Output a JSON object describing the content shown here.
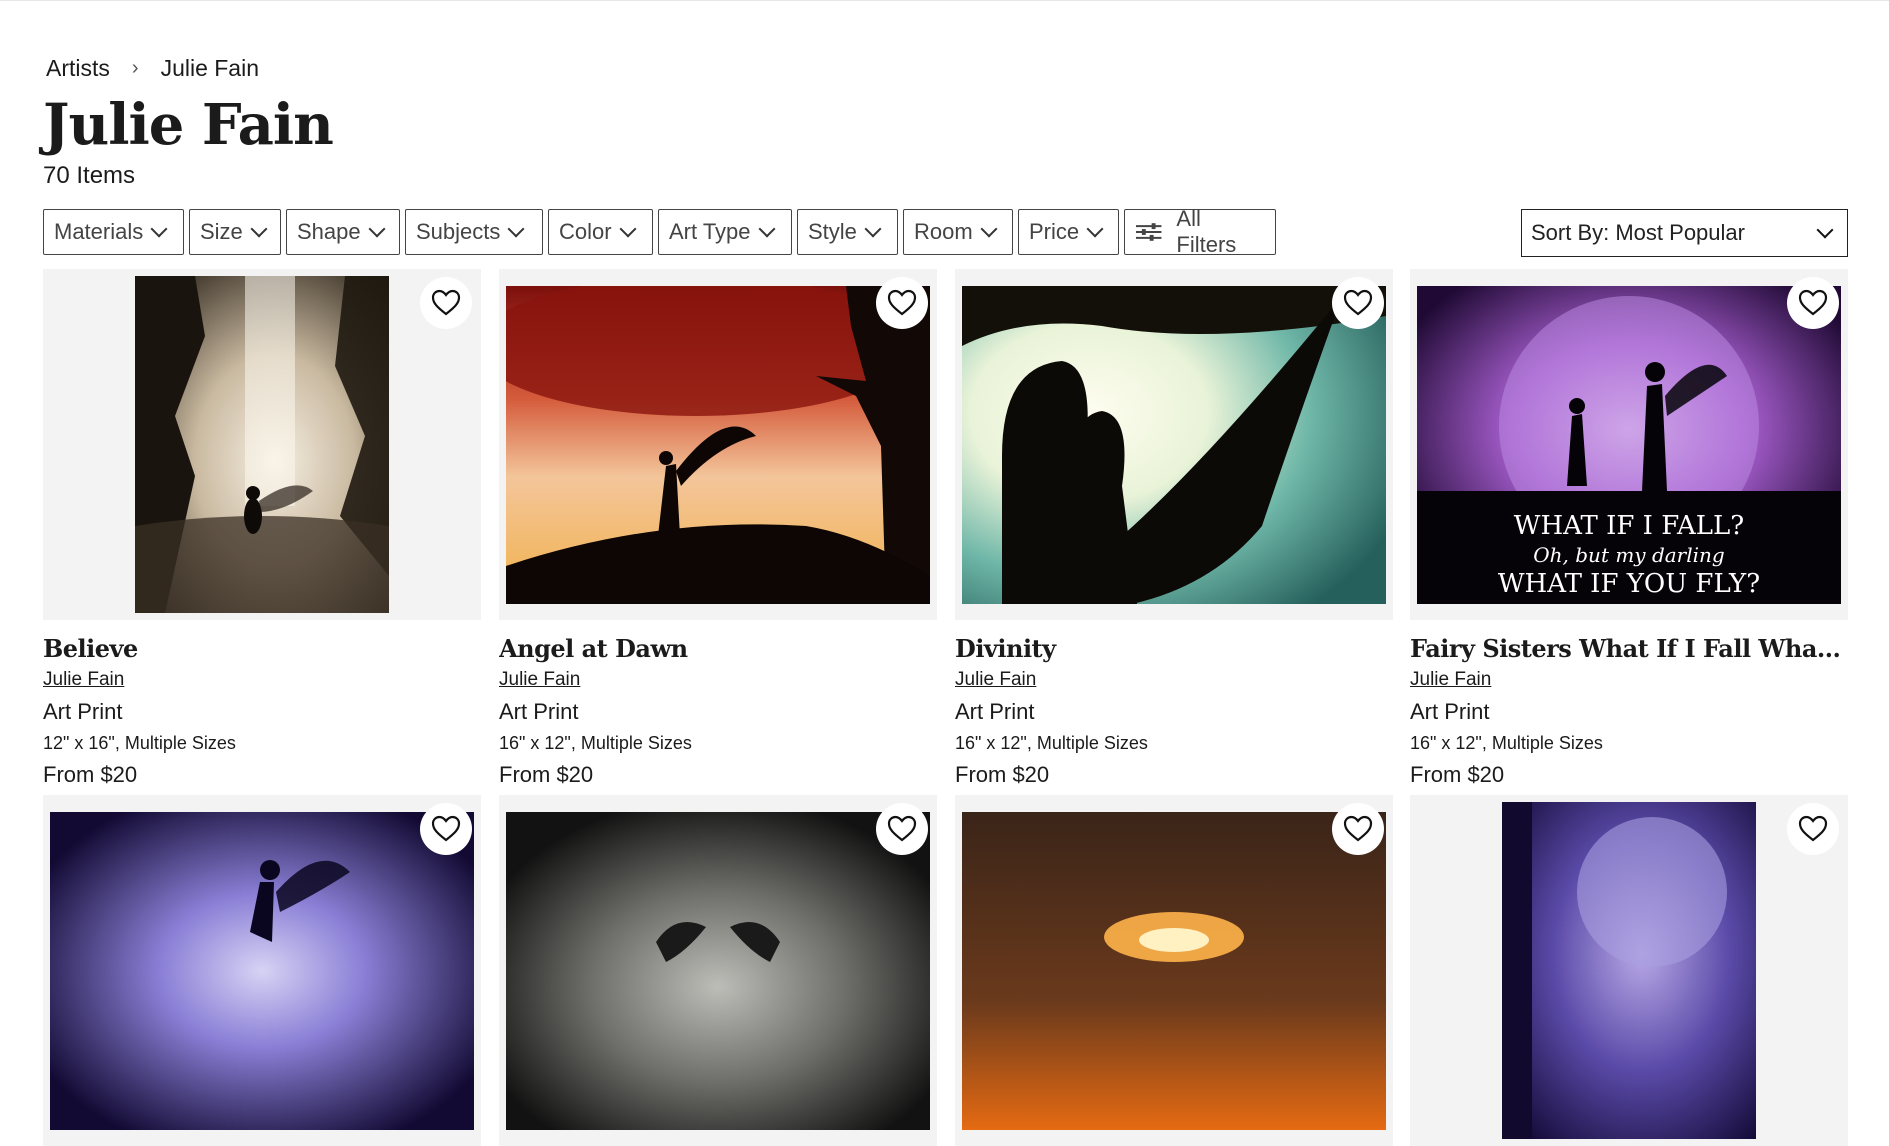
{
  "breadcrumb": {
    "root": "Artists",
    "current": "Julie Fain"
  },
  "page": {
    "title": "Julie Fain",
    "count": "70 Items"
  },
  "filters": [
    "Materials",
    "Size",
    "Shape",
    "Subjects",
    "Color",
    "Art Type",
    "Style",
    "Room",
    "Price"
  ],
  "all_filters": "All Filters",
  "sort": {
    "label": "Sort By: Most Popular"
  },
  "products": [
    {
      "title": "Believe",
      "artist": "Julie Fain",
      "type": "Art Print",
      "size": "12\" x 16\", Multiple Sizes",
      "price": "From $20"
    },
    {
      "title": "Angel at Dawn",
      "artist": "Julie Fain",
      "type": "Art Print",
      "size": "16\" x 12\", Multiple Sizes",
      "price": "From $20"
    },
    {
      "title": "Divinity",
      "artist": "Julie Fain",
      "type": "Art Print",
      "size": "16\" x 12\", Multiple Sizes",
      "price": "From $20"
    },
    {
      "title": "Fairy Sisters What If I Fall What If You Fly",
      "artist": "Julie Fain",
      "type": "Art Print",
      "size": "16\" x 12\", Multiple Sizes",
      "price": "From $20"
    }
  ],
  "art_text": {
    "line1": "WHAT IF I FALL?",
    "line2": "Oh, but my darling",
    "line3": "WHAT IF YOU FLY?"
  },
  "colors": {
    "accent": "#1b1b1b",
    "card_bg": "#f3f3f3"
  }
}
